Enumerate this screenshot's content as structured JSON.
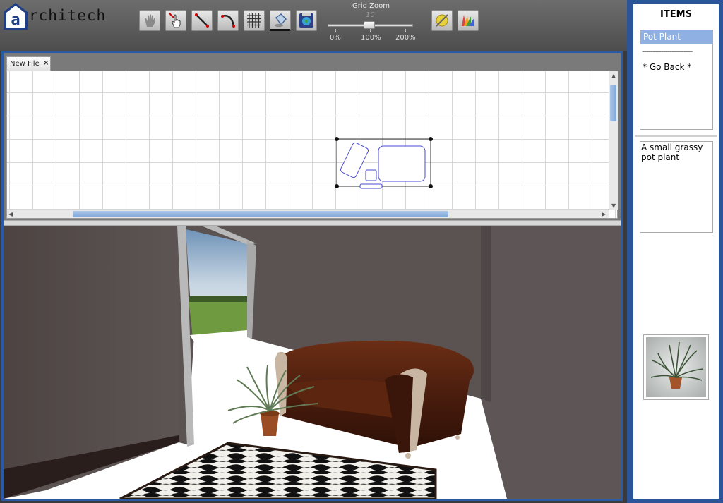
{
  "app": {
    "logo_letter": "a",
    "logo_text": "rchitech"
  },
  "toolbar": {
    "tools": [
      {
        "name": "hand-tool-icon",
        "label": "Pan"
      },
      {
        "name": "select-pointer-icon",
        "label": "Select"
      },
      {
        "name": "draw-line-icon",
        "label": "Line"
      },
      {
        "name": "draw-curve-icon",
        "label": "Curve"
      },
      {
        "name": "grid-toggle-icon",
        "label": "Grid"
      },
      {
        "name": "paint-bucket-icon",
        "label": "Fill"
      },
      {
        "name": "save-disk-icon",
        "label": "Save"
      },
      {
        "name": "sun-lighting-icon",
        "label": "Lighting"
      },
      {
        "name": "color-palette-icon",
        "label": "Colors"
      }
    ]
  },
  "grid_zoom": {
    "title": "Grid Zoom",
    "value": "10",
    "min_label": "0%",
    "mid_label": "100%",
    "max_label": "200%",
    "level_percent": 100
  },
  "tab": {
    "label": "New File",
    "close": "×"
  },
  "sidebar": {
    "title": "ITEMS",
    "items": [
      {
        "label": "Pot Plant",
        "selected": true
      },
      {
        "label": "------------------------",
        "selected": false
      },
      {
        "label": "* Go Back *",
        "selected": false
      }
    ],
    "description": "A small grassy pot plant",
    "preview_icon": "pot-plant-thumbnail"
  },
  "colors": {
    "accent_border": "#2a5aa7",
    "selection": "#8eb0e2",
    "wall": "#5b5352",
    "floor": "#ffffff",
    "sofa": "#4a1d0e"
  }
}
